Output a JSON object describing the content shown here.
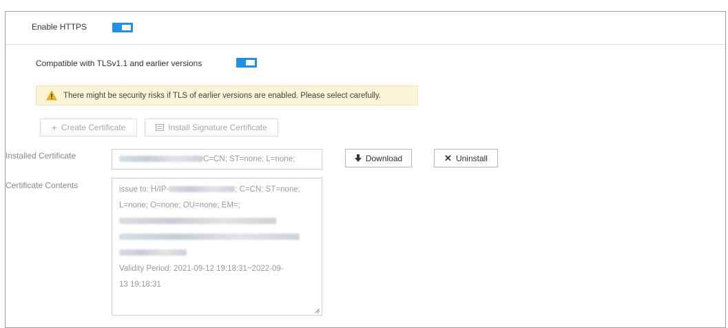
{
  "https": {
    "enable_label": "Enable HTTPS",
    "enabled": true,
    "tls_compat_label": "Compatible with TLSv1.1 and earlier versions",
    "tls_compat_enabled": true
  },
  "warning": {
    "text": "There might be security risks if TLS of earlier versions are enabled. Please select carefully.",
    "icon": "warning-icon"
  },
  "actions": {
    "create_label": "Create Certificate",
    "create_icon": "plus-icon",
    "install_label": "Install Signature Certificate",
    "install_icon": "certificate-icon"
  },
  "installed": {
    "label": "Installed Certificate",
    "value_visible": "C=CN; ST=none; L=none;",
    "download_label": "Download",
    "download_icon": "download-icon",
    "uninstall_label": "Uninstall",
    "uninstall_icon": "close-icon"
  },
  "contents": {
    "label": "Certificate Contents",
    "line1_prefix": "issue to: H/IP-",
    "line1_suffix": "; C=CN; ST=none;",
    "line2": "L=none; O=none; OU=none; EM=;",
    "validity_line1": "Validity Period: 2021-09-12 19:18:31~2022-09-",
    "validity_line2": "13 19:18:31"
  }
}
